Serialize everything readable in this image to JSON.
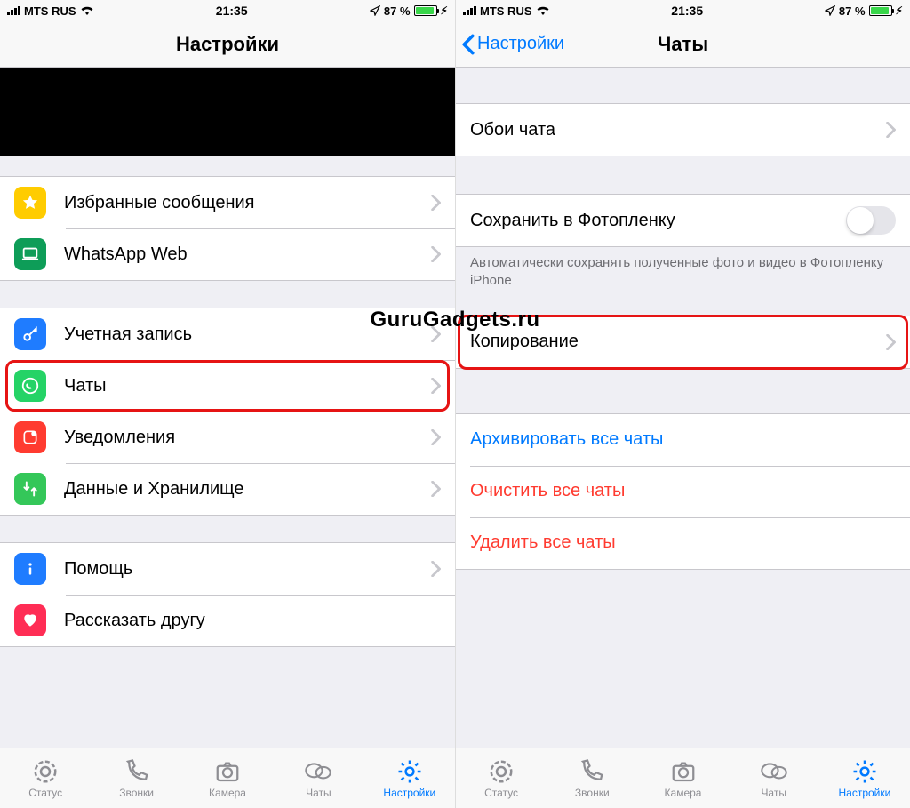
{
  "watermark": "GuruGadgets.ru",
  "status": {
    "carrier": "MTS RUS",
    "time": "21:35",
    "battery_pct": "87 %"
  },
  "left": {
    "nav_title": "Настройки",
    "rows": {
      "starred": "Избранные сообщения",
      "web": "WhatsApp Web",
      "account": "Учетная запись",
      "chats": "Чаты",
      "notifications": "Уведомления",
      "data": "Данные и Хранилище",
      "help": "Помощь",
      "tell": "Рассказать другу"
    }
  },
  "right": {
    "nav_back": "Настройки",
    "nav_title": "Чаты",
    "rows": {
      "wallpaper": "Обои чата",
      "save_photos": "Сохранить в Фотопленку",
      "save_photos_foot": "Автоматически сохранять полученные фото и видео в Фотопленку iPhone",
      "backup": "Копирование",
      "archive": "Архивировать все чаты",
      "clear": "Очистить все чаты",
      "delete": "Удалить все чаты"
    }
  },
  "tabs": {
    "status": "Статус",
    "calls": "Звонки",
    "camera": "Камера",
    "chats": "Чаты",
    "settings": "Настройки"
  }
}
